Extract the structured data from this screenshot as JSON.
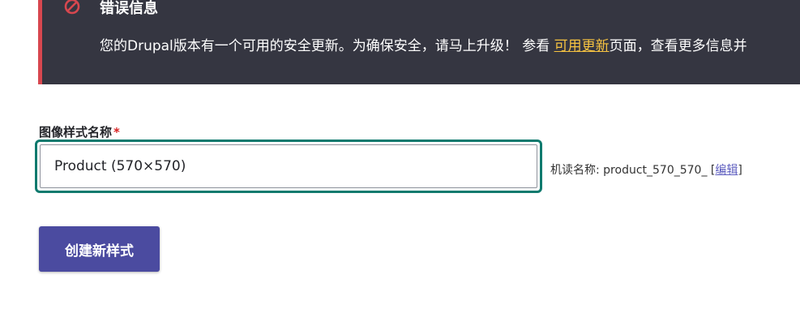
{
  "message": {
    "title": "错误信息",
    "text_before_link": "您的Drupal版本有一个可用的安全更新。为确保安全，请马上升级！ 参看 ",
    "link_text": "可用更新",
    "text_after_link": "页面，查看更多信息并",
    "icon": "error-prohibited-icon",
    "colors": {
      "background": "#353641",
      "accent_border": "#d7474f",
      "link": "#f6c341"
    }
  },
  "form": {
    "name_field": {
      "label": "图像样式名称",
      "required_marker": "*",
      "value": "Product (570×570)"
    },
    "machine_name": {
      "prefix": "机读名称: product_570_570_ [",
      "edit_link": "编辑",
      "suffix": "]"
    },
    "submit_label": "创建新样式",
    "colors": {
      "focus_ring": "#0f7a6e",
      "button": "#4b4ba0"
    }
  }
}
